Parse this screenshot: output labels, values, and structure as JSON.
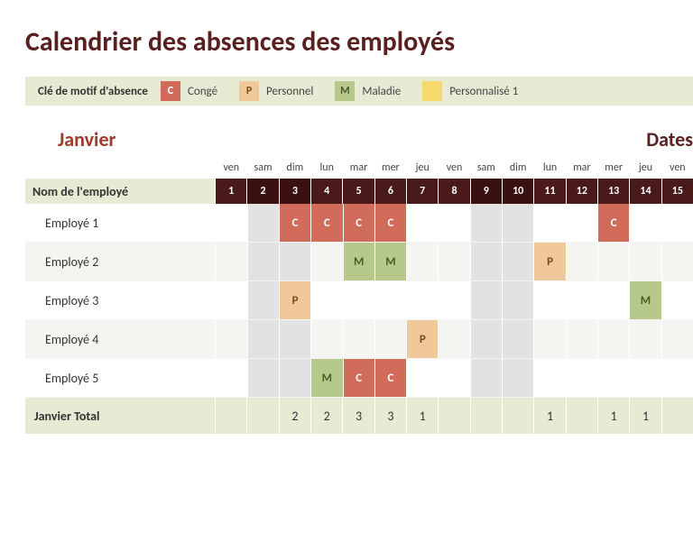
{
  "title": "Calendrier des absences des employés",
  "legend_title": "Clé de motif d'absence",
  "legend": [
    {
      "code": "C",
      "label": "Congé",
      "cls": "code-C"
    },
    {
      "code": "P",
      "label": "Personnel",
      "cls": "code-P"
    },
    {
      "code": "M",
      "label": "Maladie",
      "cls": "code-M"
    },
    {
      "code": "",
      "label": "Personnalisé 1",
      "cls": "code-X"
    }
  ],
  "month": "Janvier",
  "dates_label": "Dates",
  "employee_header": "Nom de l'employé",
  "days": [
    {
      "n": 1,
      "dow": "ven",
      "we": false
    },
    {
      "n": 2,
      "dow": "sam",
      "we": true
    },
    {
      "n": 3,
      "dow": "dim",
      "we": true
    },
    {
      "n": 4,
      "dow": "lun",
      "we": false
    },
    {
      "n": 5,
      "dow": "mar",
      "we": false
    },
    {
      "n": 6,
      "dow": "mer",
      "we": false
    },
    {
      "n": 7,
      "dow": "jeu",
      "we": false
    },
    {
      "n": 8,
      "dow": "ven",
      "we": false
    },
    {
      "n": 9,
      "dow": "sam",
      "we": true
    },
    {
      "n": 10,
      "dow": "dim",
      "we": true
    },
    {
      "n": 11,
      "dow": "lun",
      "we": false
    },
    {
      "n": 12,
      "dow": "mar",
      "we": false
    },
    {
      "n": 13,
      "dow": "mer",
      "we": false
    },
    {
      "n": 14,
      "dow": "jeu",
      "we": false
    },
    {
      "n": 15,
      "dow": "ven",
      "we": false
    }
  ],
  "employees": [
    {
      "name": "Employé 1",
      "abs": {
        "3": "C",
        "4": "C",
        "5": "C",
        "6": "C",
        "13": "C"
      }
    },
    {
      "name": "Employé 2",
      "abs": {
        "5": "M",
        "6": "M",
        "11": "P"
      }
    },
    {
      "name": "Employé 3",
      "abs": {
        "3": "P",
        "14": "M"
      }
    },
    {
      "name": "Employé 4",
      "abs": {
        "7": "P"
      }
    },
    {
      "name": "Employé 5",
      "abs": {
        "4": "M",
        "5": "C",
        "6": "C"
      }
    }
  ],
  "total_label": "Janvier Total",
  "totals": {
    "3": 2,
    "4": 2,
    "5": 3,
    "6": 3,
    "7": 1,
    "11": 1,
    "13": 1,
    "14": 1
  }
}
